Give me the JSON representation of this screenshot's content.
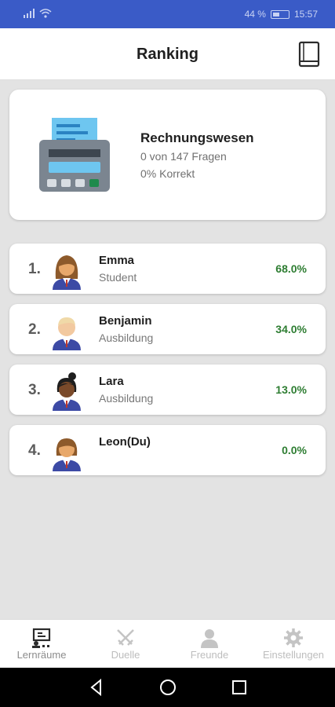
{
  "status_bar": {
    "battery": "44 %",
    "time": "15:57"
  },
  "header": {
    "title": "Ranking",
    "book_icon": "book-icon"
  },
  "subject": {
    "name": "Rechnungswesen",
    "progress": "0 von 147 Fragen",
    "correct": "0% Korrekt",
    "icon": "cash-register-icon"
  },
  "ranking": [
    {
      "rank": "1.",
      "name": "Emma",
      "role": "Student",
      "score": "68.0%"
    },
    {
      "rank": "2.",
      "name": "Benjamin",
      "role": "Ausbildung",
      "score": "34.0%"
    },
    {
      "rank": "3.",
      "name": "Lara",
      "role": "Ausbildung",
      "score": "13.0%"
    },
    {
      "rank": "4.",
      "name": "Leon(Du)",
      "role": "",
      "score": "0.0%"
    }
  ],
  "bottom_nav": [
    {
      "label": "Lernräume",
      "icon": "classroom-icon",
      "active": true
    },
    {
      "label": "Duelle",
      "icon": "crossed-swords-icon",
      "active": false
    },
    {
      "label": "Freunde",
      "icon": "person-icon",
      "active": false
    },
    {
      "label": "Einstellungen",
      "icon": "gear-icon",
      "active": false
    }
  ],
  "colors": {
    "status_bar": "#3a5bc7",
    "score": "#2e7d32",
    "background": "#e3e3e3"
  }
}
